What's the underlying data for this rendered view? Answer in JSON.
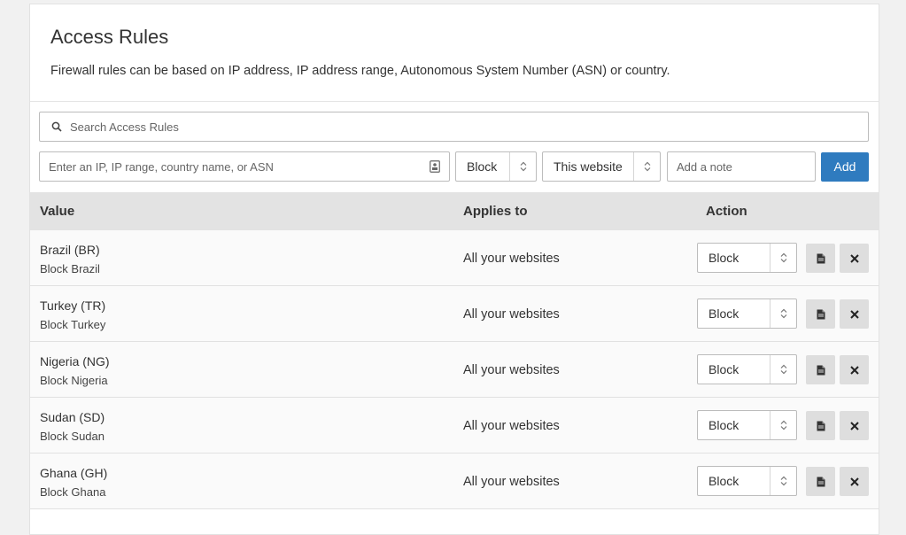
{
  "header": {
    "title": "Access Rules",
    "description": "Firewall rules can be based on IP address, IP address range, Autonomous System Number (ASN) or country."
  },
  "search": {
    "placeholder": "Search Access Rules",
    "icon": "search-icon"
  },
  "add_form": {
    "value_placeholder": "Enter an IP, IP range, country name, or ASN",
    "mode_selected": "Block",
    "scope_selected": "This website",
    "note_placeholder": "Add a note",
    "add_label": "Add",
    "accent_color": "#2f7bbf"
  },
  "table": {
    "columns": {
      "value": "Value",
      "applies_to": "Applies to",
      "action": "Action"
    },
    "rows": [
      {
        "value": "Brazil (BR)",
        "note": "Block Brazil",
        "applies_to": "All your websites",
        "action": "Block"
      },
      {
        "value": "Turkey (TR)",
        "note": "Block Turkey",
        "applies_to": "All your websites",
        "action": "Block"
      },
      {
        "value": "Nigeria (NG)",
        "note": "Block Nigeria",
        "applies_to": "All your websites",
        "action": "Block"
      },
      {
        "value": "Sudan (SD)",
        "note": "Block Sudan",
        "applies_to": "All your websites",
        "action": "Block"
      },
      {
        "value": "Ghana (GH)",
        "note": "Block Ghana",
        "applies_to": "All your websites",
        "action": "Block"
      }
    ]
  }
}
